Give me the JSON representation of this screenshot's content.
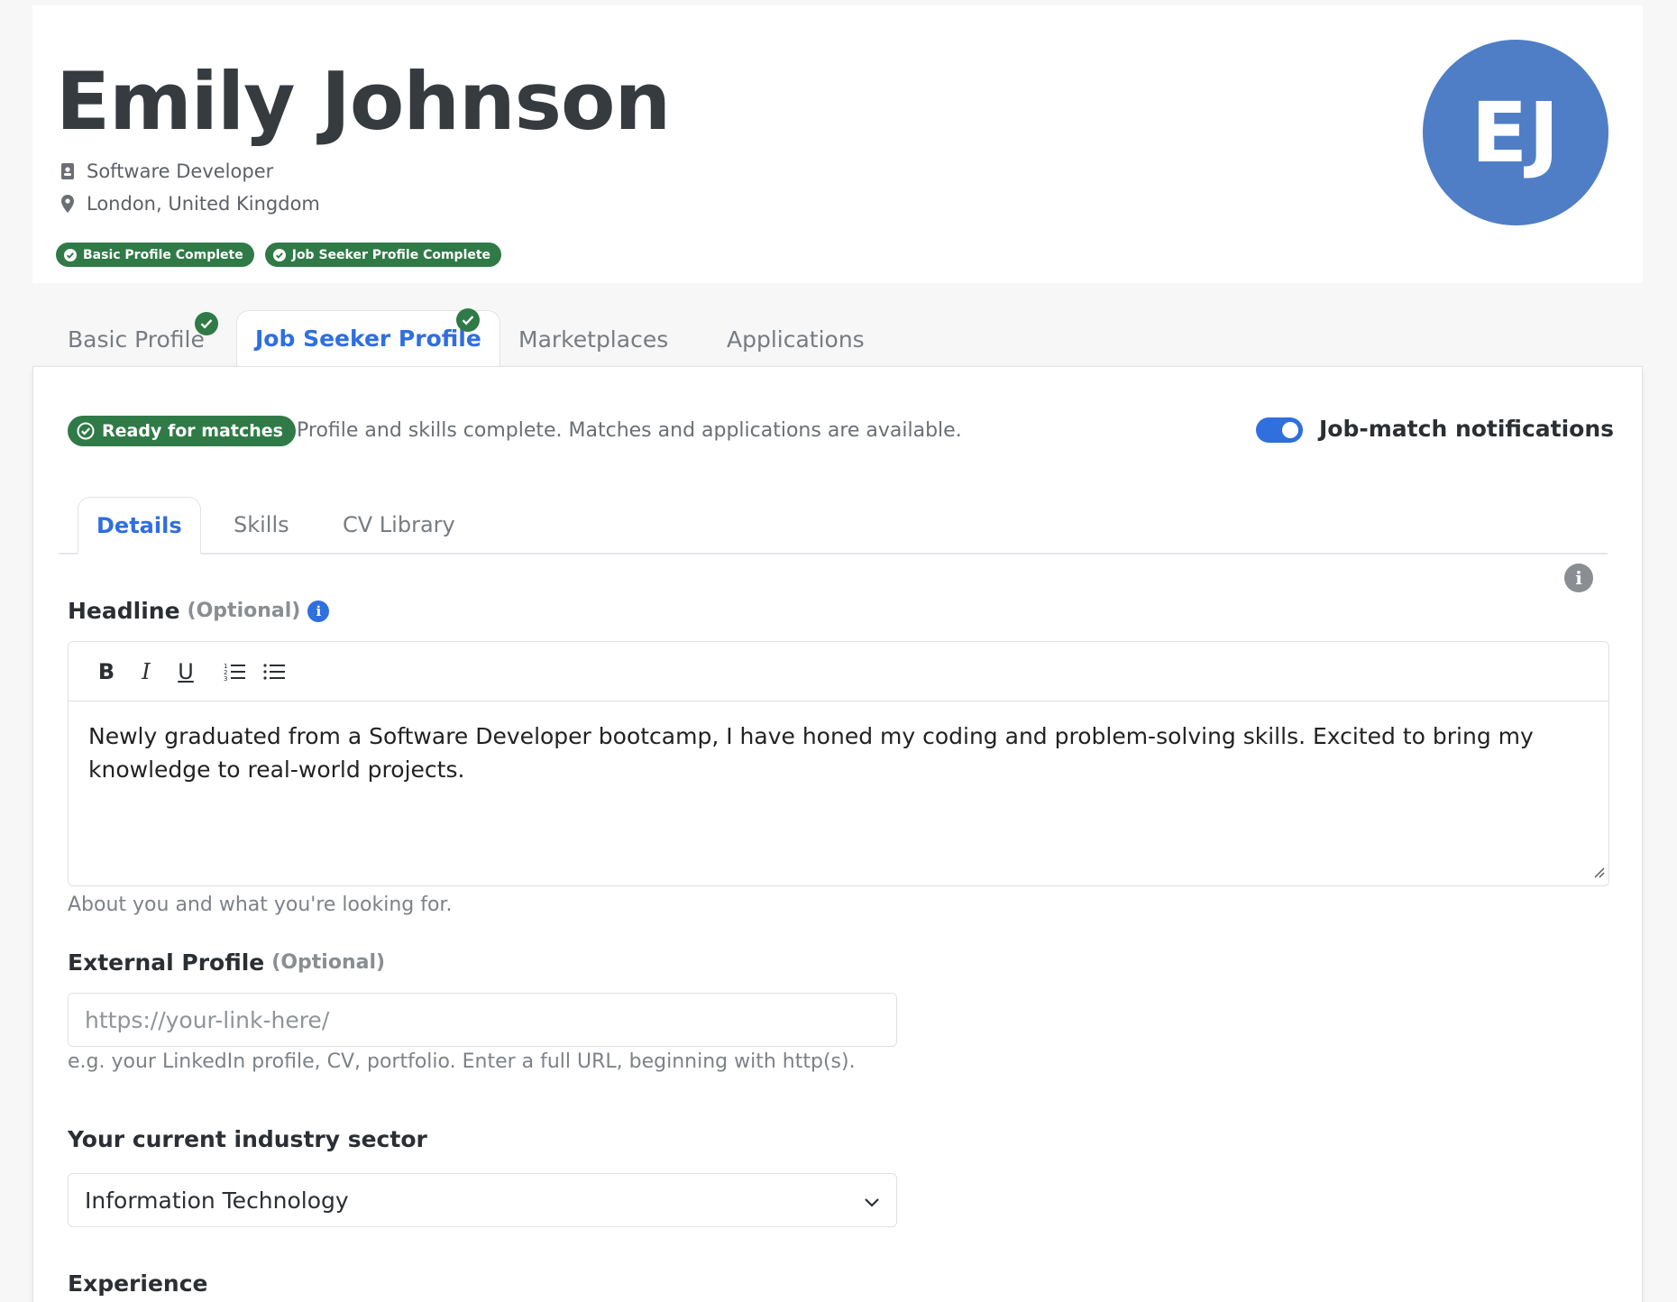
{
  "profile": {
    "name": "Emily Johnson",
    "job_title": "Software Developer",
    "location": "London, United Kingdom",
    "initials": "EJ",
    "badges": [
      "Basic Profile Complete",
      "Job Seeker Profile Complete"
    ]
  },
  "top_tabs": [
    "Basic Profile",
    "Job Seeker Profile",
    "Marketplaces",
    "Applications"
  ],
  "status": {
    "pill": "Ready for matches",
    "text": "Profile and skills complete. Matches and applications are available.",
    "toggle_label": "Job-match notifications",
    "toggle_on": true
  },
  "sub_tabs": [
    "Details",
    "Skills",
    "CV Library"
  ],
  "headline": {
    "label": "Headline",
    "optional": "(Optional)",
    "text": "Newly graduated from a Software Developer bootcamp, I have honed my coding and problem-solving skills. Excited to bring my knowledge to real-world projects.",
    "help": "About you and what you're looking for.",
    "toolbar": [
      "B",
      "I",
      "U"
    ]
  },
  "external_profile": {
    "label": "External Profile",
    "optional": "(Optional)",
    "placeholder": "https://your-link-here/",
    "help": "e.g. your LinkedIn profile, CV, portfolio. Enter a full URL, beginning with http(s)."
  },
  "industry": {
    "label": "Your current industry sector",
    "value": "Information Technology"
  },
  "experience": {
    "label": "Experience"
  },
  "colors": {
    "accent": "#2f6fde",
    "success": "#2f7a46",
    "avatar": "#4f7ec6"
  }
}
